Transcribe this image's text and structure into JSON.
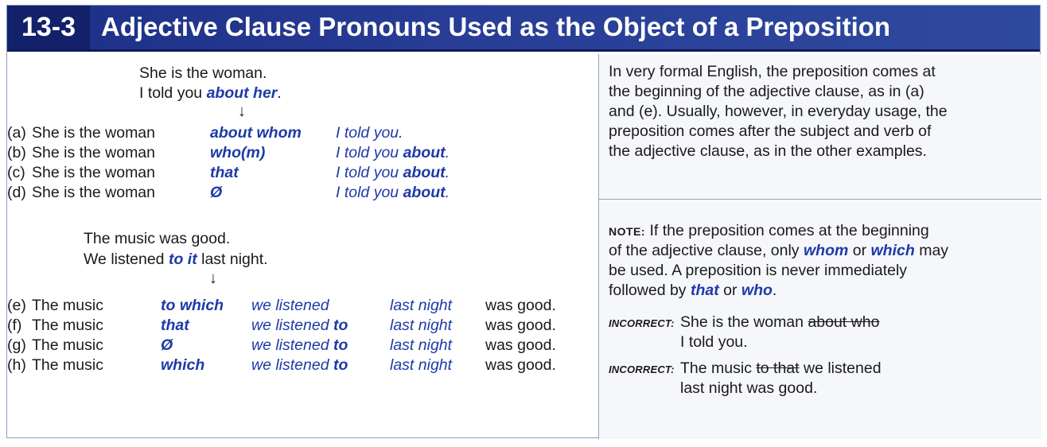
{
  "header": {
    "number": "13-3",
    "title": "Adjective Clause Pronouns Used as the Object of a Preposition"
  },
  "left": {
    "setup1": {
      "line1": "She is the woman.",
      "line2_pre": "I told you ",
      "line2_em": "about her",
      "line2_post": "."
    },
    "arrow": "↓",
    "rows1": [
      {
        "label": "(a)",
        "main": "She is the woman",
        "pronoun": "about whom",
        "clause_pre": "I told you",
        "clause_em": "",
        "clause_post": "."
      },
      {
        "label": "(b)",
        "main": "She is the woman",
        "pronoun": "who(m)",
        "clause_pre": "I told you ",
        "clause_em": "about",
        "clause_post": "."
      },
      {
        "label": "(c)",
        "main": "She is the woman",
        "pronoun": "that",
        "clause_pre": "I told you ",
        "clause_em": "about",
        "clause_post": "."
      },
      {
        "label": "(d)",
        "main": "She is the woman",
        "pronoun": "Ø",
        "clause_pre": "I told you ",
        "clause_em": "about",
        "clause_post": "."
      }
    ],
    "setup2": {
      "line1": "The music was good.",
      "line2_pre": "We listened ",
      "line2_em": "to it",
      "line2_post": " last night."
    },
    "rows2": [
      {
        "label": "(e)",
        "main": "The music",
        "pronoun": "to which",
        "clause_pre": "we listened",
        "clause_em": "",
        "time": "last night",
        "end": "was good."
      },
      {
        "label": "(f)",
        "main": "The music",
        "pronoun": "that",
        "clause_pre": "we listened ",
        "clause_em": "to",
        "time": "last night",
        "end": "was good."
      },
      {
        "label": "(g)",
        "main": "The music",
        "pronoun": "Ø",
        "clause_pre": "we listened ",
        "clause_em": "to",
        "time": "last night",
        "end": "was good."
      },
      {
        "label": "(h)",
        "main": "The music",
        "pronoun": "which",
        "clause_pre": "we listened ",
        "clause_em": "to",
        "time": "last night",
        "end": "was good."
      }
    ]
  },
  "right": {
    "explanation": [
      "In very formal English, the preposition comes at",
      "the beginning of the adjective clause, as in (a)",
      "and (e).  Usually, however, in everyday usage, the",
      "preposition comes after the subject and verb of",
      "the adjective clause, as in the other examples."
    ],
    "note": {
      "label": "NOTE:",
      "line1": "If the preposition comes at the beginning",
      "line2_pre": "of the adjective clause, only ",
      "line2_em1": "whom",
      "line2_mid": " or ",
      "line2_em2": "which",
      "line2_post": " may",
      "line3": "be used.  A preposition is never immediately",
      "line4_pre": "followed by ",
      "line4_em1": "that",
      "line4_mid": " or ",
      "line4_em2": "who",
      "line4_post": "."
    },
    "incorrect1": {
      "label": "INCORRECT:",
      "pre": "She is the woman ",
      "struck": "about who",
      "line2": "I told you."
    },
    "incorrect2": {
      "label": "INCORRECT:",
      "pre": "The music ",
      "struck": "to that",
      "post": " we listened",
      "line2": "last night was good."
    }
  }
}
